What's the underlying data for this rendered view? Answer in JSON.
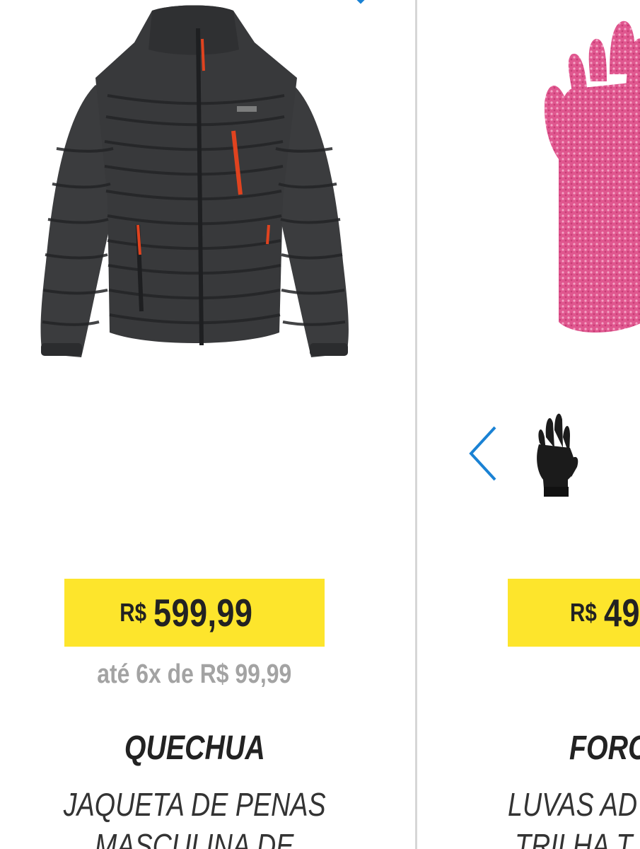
{
  "products": [
    {
      "brand": "QUECHUA",
      "name_line1": "JAQUETA DE PENAS",
      "name_line2": "MASCULINA DE",
      "price_currency": "R$",
      "price_amount": "599,99",
      "installments": "até 6x de R$ 99,99",
      "icons": [
        "heart-icon",
        "jacket-image"
      ],
      "colors": {
        "jacket": "#3a3b3d",
        "zipper_accent": "#e0431f"
      }
    },
    {
      "brand": "FORC",
      "name_line1": "LUVAS AD",
      "name_line2": "TRILHA T",
      "price_currency": "R$",
      "price_amount": "49",
      "icons": [
        "chevron-left-icon",
        "glove-image",
        "glove-thumbnail"
      ],
      "colors": {
        "glove": "#e0578f"
      }
    }
  ],
  "theme": {
    "price_background": "#fde52c",
    "accent_blue": "#1a82d4",
    "installments_text": "#a3a3a3",
    "divider": "#d6d6d6"
  }
}
